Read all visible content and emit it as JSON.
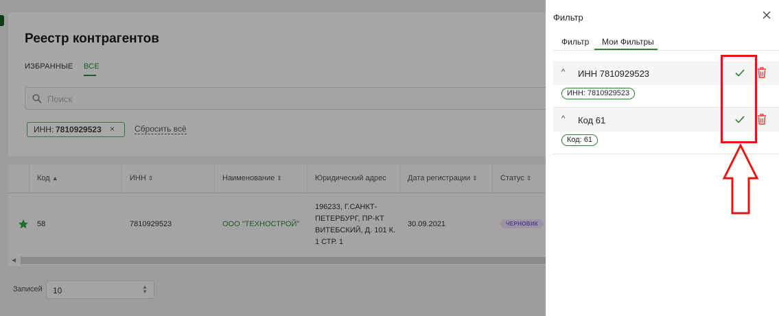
{
  "background_page": {
    "title": "Реестр контрагентов",
    "tabs": [
      {
        "label": "ИЗБРАННЫЕ",
        "active": false
      },
      {
        "label": "ВСЕ",
        "active": true
      }
    ],
    "search": {
      "placeholder": "Поиск",
      "value": ""
    },
    "active_filter_chip": {
      "prefix": "ИНН:",
      "value": "7810929523",
      "close": "×"
    },
    "reset_label": "Сбросить всё",
    "table": {
      "columns": [
        {
          "label": "Код",
          "sort_icon": "▲"
        },
        {
          "label": "ИНН",
          "sort_icon": "⇕"
        },
        {
          "label": "Наименование",
          "sort_icon": "⇕"
        },
        {
          "label": "Юридический адрес",
          "sort_icon": ""
        },
        {
          "label": "Дата регистрации",
          "sort_icon": "⇕"
        },
        {
          "label": "Статус",
          "sort_icon": "⇕"
        }
      ],
      "rows": [
        {
          "favorite_icon": "star-icon",
          "code": "58",
          "inn": "7810929523",
          "name": "ООО \"ТЕХНОСТРОЙ\"",
          "address": "196233, Г.САНКТ-ПЕТЕРБУРГ, ПР-КТ ВИТЕБСКИЙ, Д. 101 К. 1 СТР. 1",
          "date": "30.09.2021",
          "status": "ЧЕРНОВИК"
        }
      ]
    },
    "pagination": {
      "label": "Записей",
      "value": "10"
    }
  },
  "drawer": {
    "title": "Фильтр",
    "close_icon": "close-icon",
    "tabs": [
      {
        "label": "Фильтр",
        "active": false
      },
      {
        "label": "Мои Фильтры",
        "active": true
      }
    ],
    "saved_filters": [
      {
        "title": "ИНН 7810929523",
        "tag": "ИНН: 7810929523",
        "apply_icon": "check-icon",
        "delete_icon": "trash-icon"
      },
      {
        "title": "Код 61",
        "tag": "Код: 61",
        "apply_icon": "check-icon",
        "delete_icon": "trash-icon"
      }
    ]
  },
  "colors": {
    "accent_green": "#2e7d32",
    "delete_red": "#e53935",
    "annotation_red": "#ee1111",
    "overlay_gray": "#9d9d9d"
  }
}
